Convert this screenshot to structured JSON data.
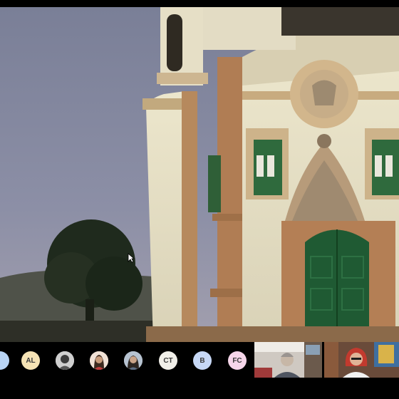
{
  "meeting": {
    "shared_view": {
      "icon": "church-facade-video"
    },
    "participants": [
      {
        "initials": "",
        "color": "#b9d4f5"
      },
      {
        "initials": "AL",
        "color": "#f6e3b5"
      },
      {
        "initials": "",
        "icon": "avatar-photo"
      },
      {
        "initials": "",
        "icon": "avatar-photo"
      },
      {
        "initials": "",
        "icon": "avatar-photo"
      },
      {
        "initials": "CT",
        "color": "#f1efe9"
      },
      {
        "initials": "B",
        "color": "#c7d8f6"
      },
      {
        "initials": "FC",
        "color": "#f6d6ea"
      }
    ],
    "video_tiles": [
      {
        "icon": "participant-video"
      },
      {
        "icon": "participant-video"
      }
    ]
  }
}
